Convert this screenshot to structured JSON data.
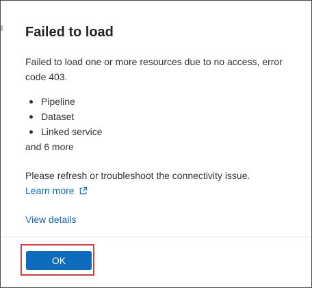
{
  "dialog": {
    "title": "Failed to load",
    "message": "Failed to load one or more resources due to no access, error code 403.",
    "resources": [
      "Pipeline",
      "Dataset",
      "Linked service"
    ],
    "more_text": "and 6 more",
    "refresh_text": "Please refresh or troubleshoot the connectivity issue.",
    "learn_more_label": "Learn more",
    "learn_more_icon": "external-link-icon",
    "view_details_label": "View details",
    "ok_label": "OK"
  },
  "colors": {
    "link": "#0f6cbd",
    "primary_button": "#0f6cbd",
    "highlight_border": "#e0393e",
    "text": "#323130"
  }
}
